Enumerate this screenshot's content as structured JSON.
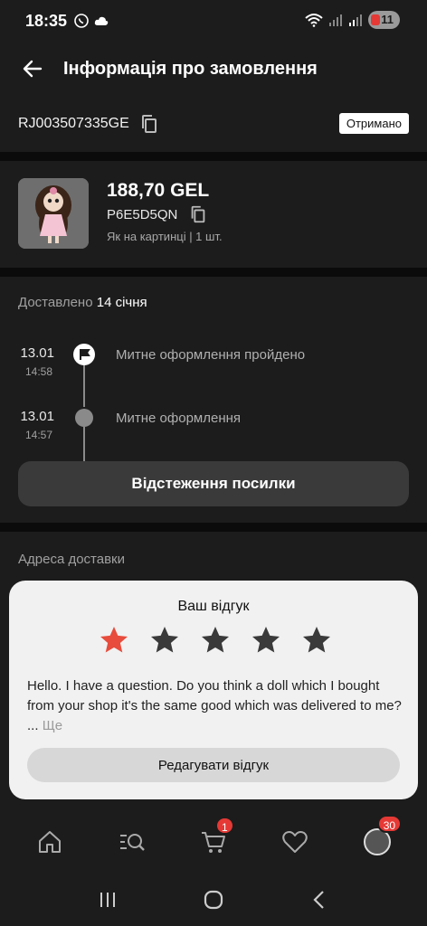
{
  "status_bar": {
    "time": "18:35",
    "battery": "11"
  },
  "header": {
    "title": "Інформація про замовлення"
  },
  "order": {
    "tracking_number": "RJ003507335GE",
    "status": "Отримано"
  },
  "product": {
    "price": "188,70 GEL",
    "sku": "P6E5D5QN",
    "variant": "Як на картинці | 1 шт."
  },
  "delivery": {
    "delivered_prefix": "Доставлено",
    "delivered_date": "14 січня",
    "events": [
      {
        "date": "13.01",
        "time": "14:58",
        "text": "Митне оформлення пройдено"
      },
      {
        "date": "13.01",
        "time": "14:57",
        "text": "Митне оформлення"
      }
    ],
    "track_button": "Відстеження посилки"
  },
  "address": {
    "label": "Адреса доставки"
  },
  "review": {
    "title": "Ваш відгук",
    "rating": 1,
    "max_rating": 5,
    "text": "Hello. I have a question. Do you think a doll which I bought from your shop it's the same good which was delivered to me? ...",
    "more_label": "Ще",
    "edit_button": "Редагувати відгук"
  },
  "bottom_nav": {
    "cart_badge": "1",
    "profile_badge": "30"
  },
  "colors": {
    "background": "#1c1c1c",
    "accent_red": "#e53935",
    "star_inactive": "#3a3a3a"
  }
}
